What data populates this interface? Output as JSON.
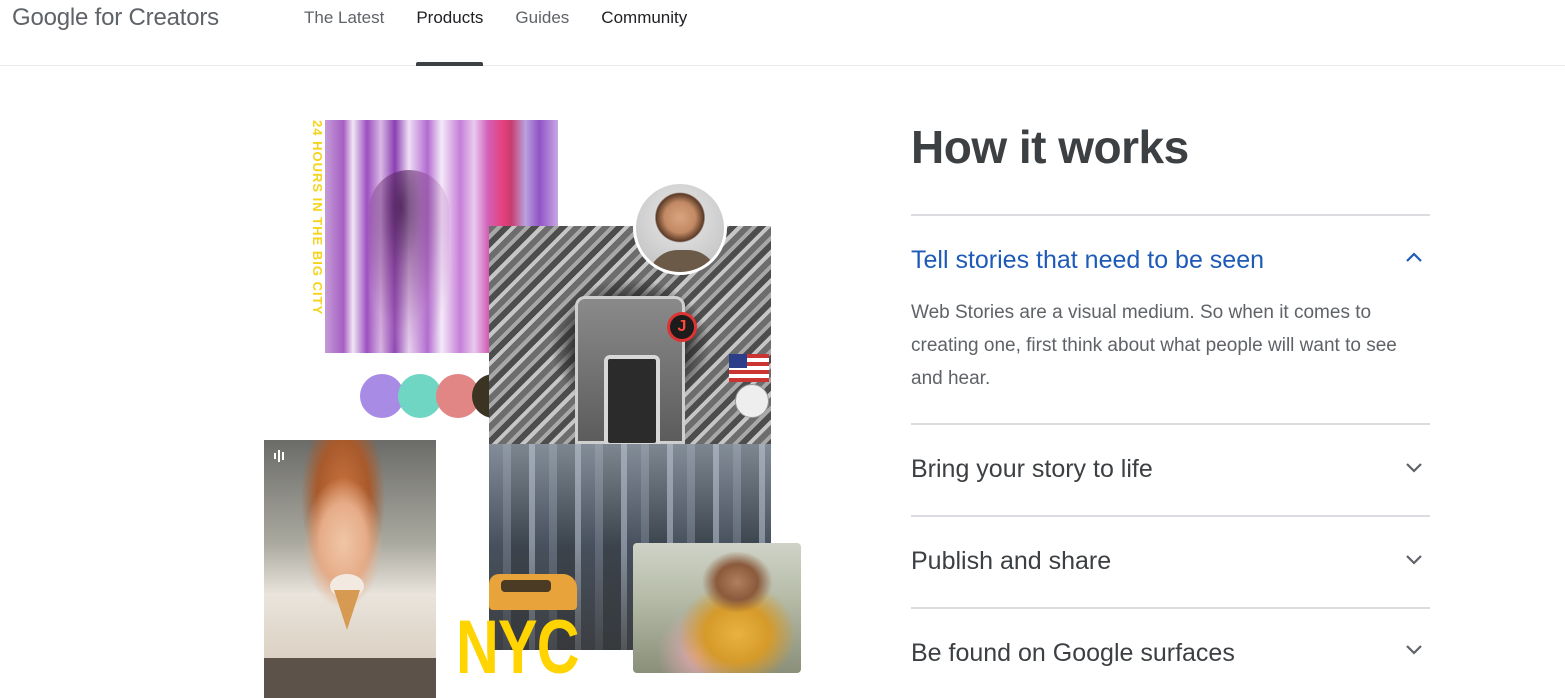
{
  "header": {
    "logo": "Google for Creators",
    "nav": [
      {
        "label": "The Latest",
        "active": false
      },
      {
        "label": "Products",
        "active": true
      },
      {
        "label": "Guides",
        "active": false
      },
      {
        "label": "Community",
        "active": false
      }
    ]
  },
  "collage": {
    "vertical_caption": "24 HOURS IN THE BIG CITY",
    "badge_letter": "J",
    "big_word": "NYC",
    "swatch_colors": [
      "#a78be5",
      "#6fd6c4",
      "#e28585",
      "#3b3423"
    ]
  },
  "section": {
    "heading": "How it works",
    "accordion": [
      {
        "title": "Tell stories that need to be seen",
        "expanded": true,
        "body": "Web Stories are a visual medium. So when it comes to creating one, first think about what people will want to see and hear."
      },
      {
        "title": "Bring your story to life",
        "expanded": false
      },
      {
        "title": "Publish and share",
        "expanded": false
      },
      {
        "title": "Be found on Google surfaces",
        "expanded": false
      }
    ]
  },
  "colors": {
    "accent": "#1e5bb8",
    "text": "#3c4043",
    "muted": "#5f6368",
    "divider": "#dadce0",
    "nyc_yellow": "#ffd400"
  }
}
